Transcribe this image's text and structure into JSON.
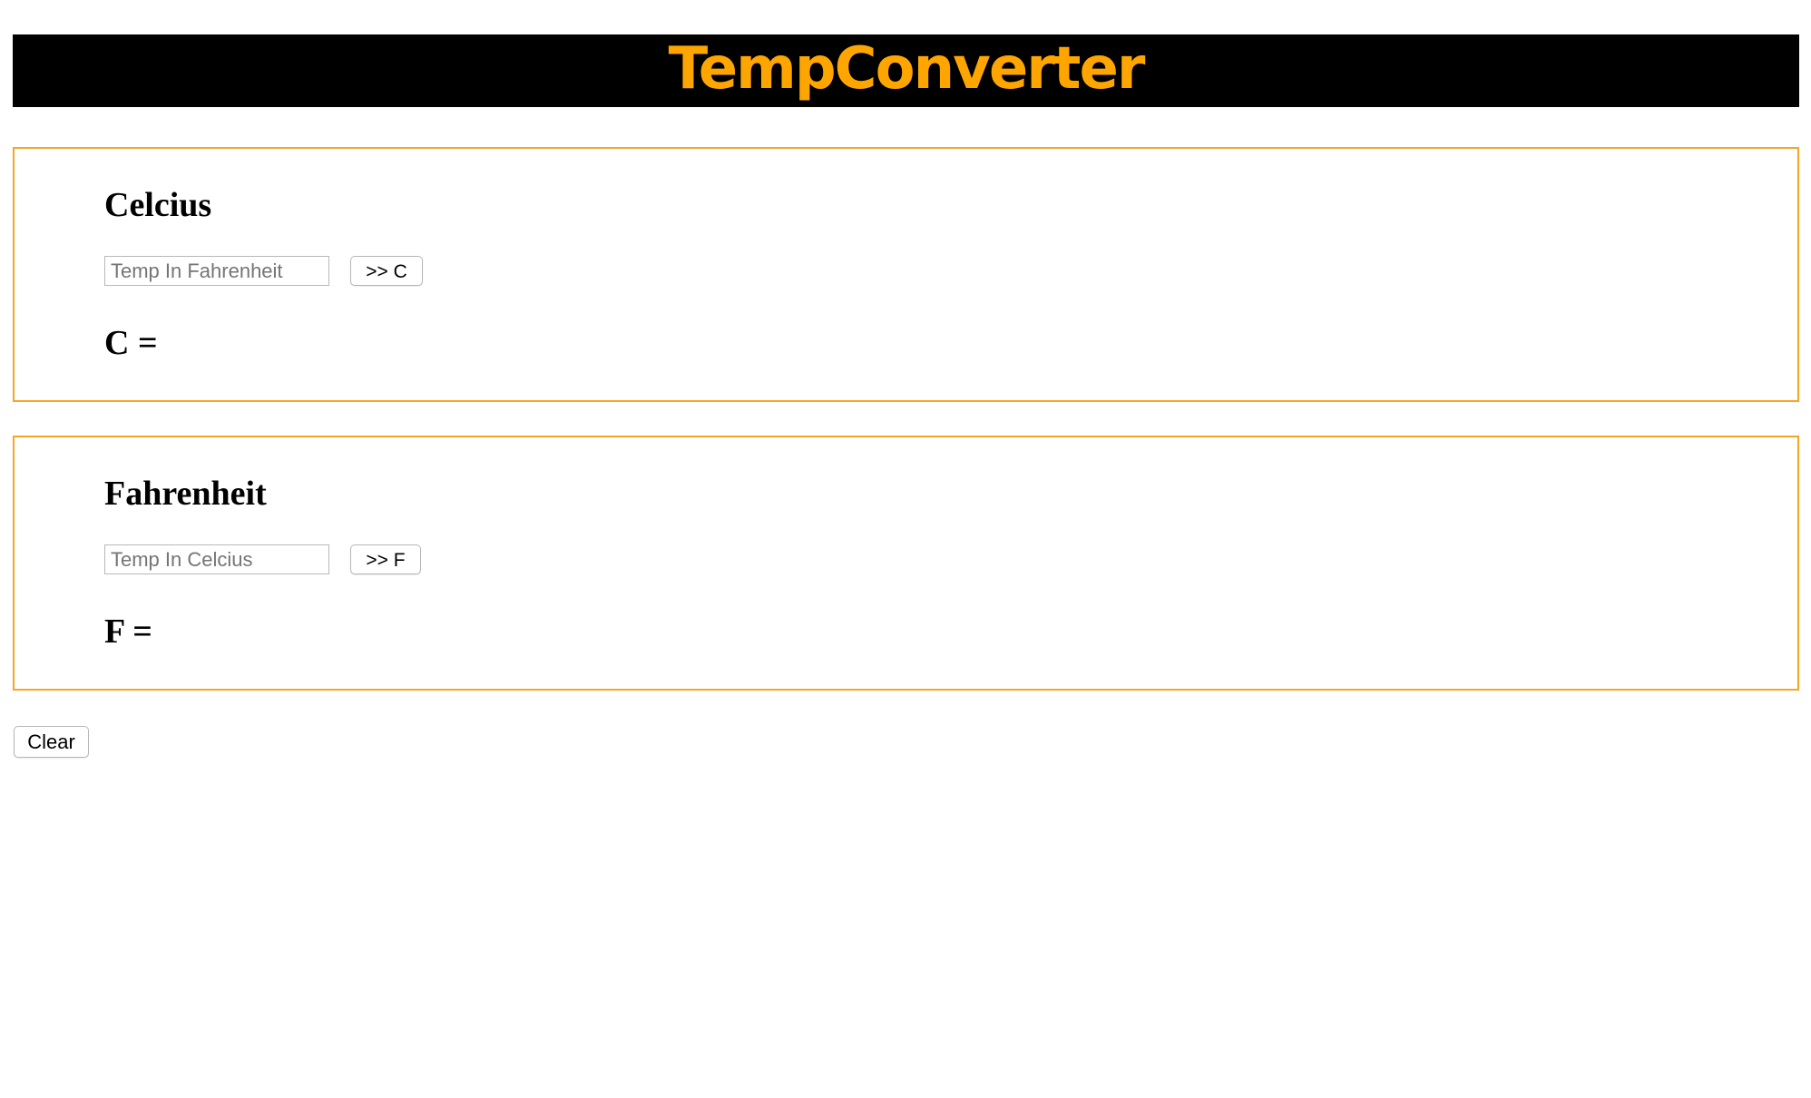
{
  "header": {
    "title": "TempConverter",
    "background_color": "#000000",
    "title_color": "#ffa500"
  },
  "card_border_color": "#f5a623",
  "celcius_card": {
    "heading": "Celcius",
    "input_placeholder": "Temp In Fahrenheit",
    "input_value": "",
    "button_label": ">> C",
    "result_label": "C ="
  },
  "fahrenheit_card": {
    "heading": "Fahrenheit",
    "input_placeholder": "Temp In Celcius",
    "input_value": "",
    "button_label": ">> F",
    "result_label": "F ="
  },
  "clear_button": {
    "label": "Clear"
  }
}
